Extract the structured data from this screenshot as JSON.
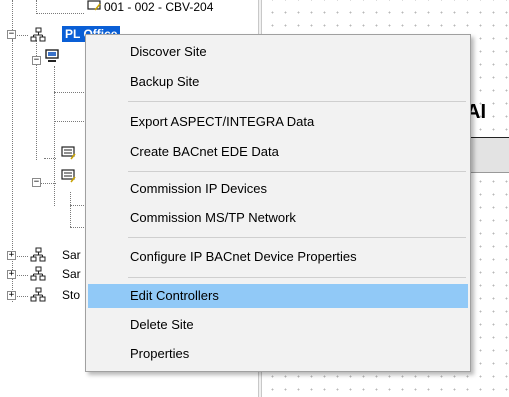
{
  "tree": {
    "top_partial_label": "001 - 002 - CBV-204",
    "selected_site_label": "PL Office",
    "site_labels_partial": [
      "Sar",
      "Sar",
      "Sto"
    ]
  },
  "right_pane": {
    "header_partial": "AI"
  },
  "context_menu": {
    "items": [
      {
        "label": "Discover Site"
      },
      {
        "label": "Backup Site"
      },
      {
        "label": "Export ASPECT/INTEGRA Data"
      },
      {
        "label": "Create BACnet EDE Data"
      },
      {
        "label": "Commission IP Devices"
      },
      {
        "label": "Commission MS/TP Network"
      },
      {
        "label": "Configure IP BACnet Device Properties"
      },
      {
        "label": "Edit Controllers",
        "highlighted": true
      },
      {
        "label": "Delete Site"
      },
      {
        "label": "Properties"
      }
    ],
    "highlight_color": "#91c9f7",
    "selection_color": "#0a5fd6"
  }
}
